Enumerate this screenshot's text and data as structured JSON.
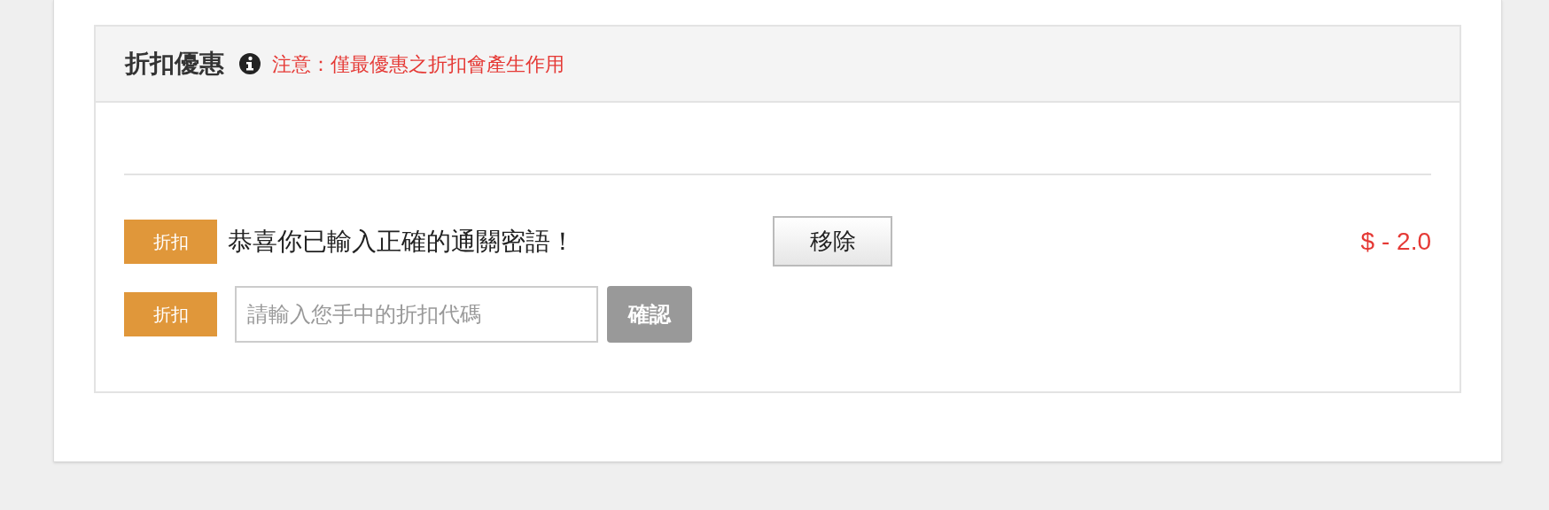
{
  "discount_panel": {
    "title": "折扣優惠",
    "notice": "注意：僅最優惠之折扣會產生作用",
    "applied": [
      {
        "badge": "折扣",
        "message": "恭喜你已輸入正確的通關密語！",
        "remove_button": "移除",
        "amount": "$ - 2.0"
      }
    ],
    "code_entry": {
      "badge": "折扣",
      "placeholder": "請輸入您手中的折扣代碼",
      "confirm_button": "確認"
    }
  }
}
